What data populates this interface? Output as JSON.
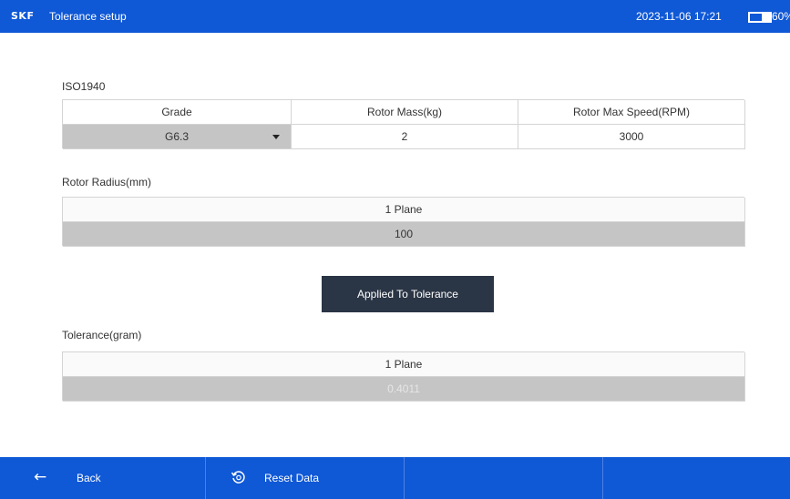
{
  "header": {
    "brand": "SKF",
    "title": "Tolerance setup",
    "datetime": "2023-11-06 17:21",
    "battery_percent": "60%",
    "battery_level": 0.6
  },
  "iso": {
    "section_label": "ISO1940",
    "columns": [
      "Grade",
      "Rotor Mass(kg)",
      "Rotor Max Speed(RPM)"
    ],
    "grade_value": "G6.3",
    "mass_value": "2",
    "speed_value": "3000"
  },
  "radius": {
    "section_label": "Rotor Radius(mm)",
    "plane_label": "1 Plane",
    "value": "100"
  },
  "apply_label": "Applied To Tolerance",
  "tolerance": {
    "section_label": "Tolerance(gram)",
    "plane_label": "1 Plane",
    "value": "0.4011"
  },
  "bottom": {
    "back_label": "Back",
    "reset_label": "Reset Data",
    "back_icon": "arrow-left-icon",
    "reset_icon": "reset-icon"
  },
  "colors": {
    "primary": "#0f58d6",
    "button_dark": "#2a3545",
    "cell_gray": "#c5c5c5"
  }
}
